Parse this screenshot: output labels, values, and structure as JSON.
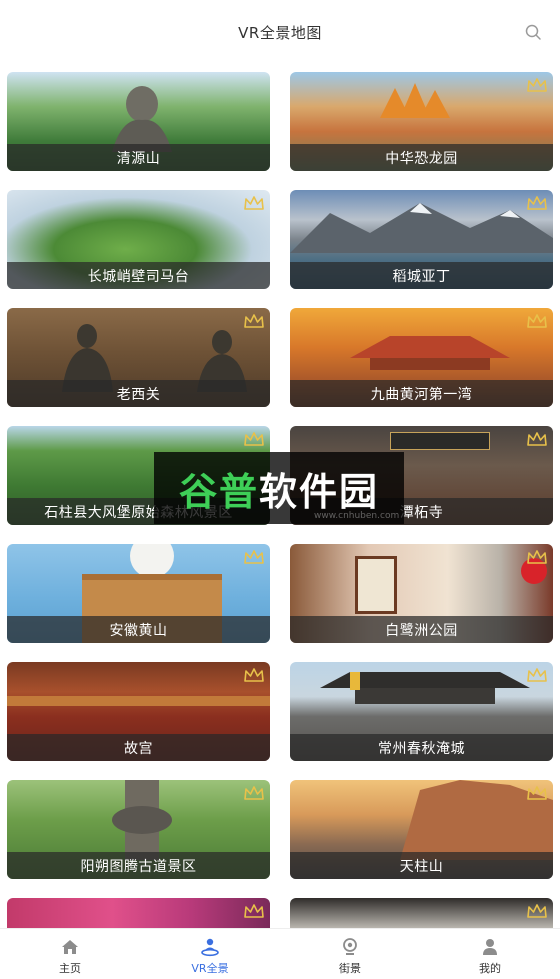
{
  "header": {
    "title": "VR全景地图",
    "search_icon": "search-icon"
  },
  "cards": [
    {
      "name": "清源山",
      "premium": false
    },
    {
      "name": "中华恐龙园",
      "premium": true
    },
    {
      "name": "长城峭壁司马台",
      "premium": true
    },
    {
      "name": "稻城亚丁",
      "premium": true
    },
    {
      "name": "老西关",
      "premium": true
    },
    {
      "name": "九曲黄河第一湾",
      "premium": true
    },
    {
      "name": "石柱县大风堡原始森林风景区",
      "premium": true
    },
    {
      "name": "潭柘寺",
      "premium": true
    },
    {
      "name": "安徽黄山",
      "premium": true
    },
    {
      "name": "白鹭洲公园",
      "premium": true
    },
    {
      "name": "故宫",
      "premium": true
    },
    {
      "name": "常州春秋淹城",
      "premium": true
    },
    {
      "name": "阳朔图腾古道景区",
      "premium": true
    },
    {
      "name": "天柱山",
      "premium": true
    },
    {
      "name": "",
      "premium": true
    },
    {
      "name": "",
      "premium": true
    }
  ],
  "watermark": {
    "text_green": "谷普",
    "text_white": "软件园",
    "sub": "www.cnhuben.com"
  },
  "tabs": [
    {
      "label": "主页",
      "icon": "home-icon",
      "active": false
    },
    {
      "label": "VR全景",
      "icon": "vr-icon",
      "active": true
    },
    {
      "label": "街景",
      "icon": "street-view-icon",
      "active": false
    },
    {
      "label": "我的",
      "icon": "profile-icon",
      "active": false
    }
  ],
  "colors": {
    "accent": "#3a6fe0",
    "crown": "#e8c14a"
  }
}
